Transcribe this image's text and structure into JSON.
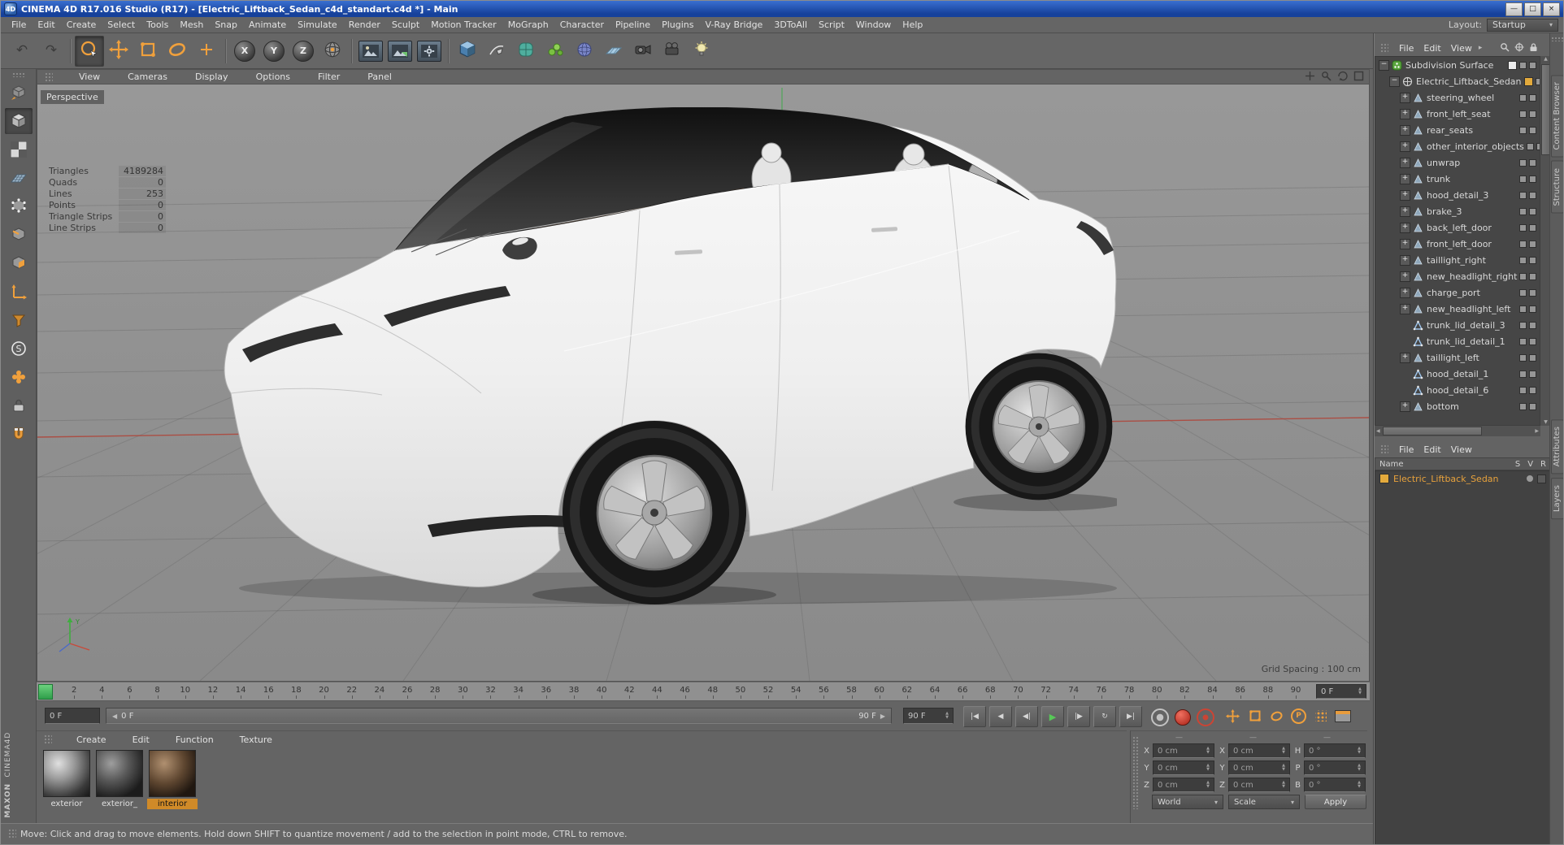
{
  "title_bar": {
    "title": "CINEMA 4D R17.016 Studio (R17) - [Electric_Liftback_Sedan_c4d_standart.c4d *] - Main",
    "window_buttons": {
      "minimize": "—",
      "maximize": "□",
      "close": "×"
    },
    "app_icon_text": "4D"
  },
  "menu_bar": {
    "items": [
      "File",
      "Edit",
      "Create",
      "Select",
      "Tools",
      "Mesh",
      "Snap",
      "Animate",
      "Simulate",
      "Render",
      "Sculpt",
      "Motion Tracker",
      "MoGraph",
      "Character",
      "Pipeline",
      "Plugins",
      "V-Ray Bridge",
      "3DToAll",
      "Script",
      "Window",
      "Help"
    ],
    "layout_label": "Layout:",
    "layout_value": "Startup"
  },
  "glyphs": {
    "undo": "↶",
    "redo": "↷",
    "axis_x": "X",
    "axis_y": "Y",
    "axis_z": "Z",
    "dropdown": "▾",
    "spin_up": "▲",
    "spin_down": "▼",
    "menu_more": "▸",
    "slider_left": "◀",
    "slider_right": "▶",
    "scroll_up": "▲",
    "scroll_down": "▼",
    "scroll_left": "◀",
    "scroll_right": "▶"
  },
  "viewport": {
    "menus": [
      "View",
      "Cameras",
      "Display",
      "Options",
      "Filter",
      "Panel"
    ],
    "label": "Perspective",
    "stats": [
      {
        "label": "Triangles",
        "value": "4189284"
      },
      {
        "label": "Quads",
        "value": "0"
      },
      {
        "label": "Lines",
        "value": "253"
      },
      {
        "label": "Points",
        "value": "0"
      },
      {
        "label": "Triangle Strips",
        "value": "0"
      },
      {
        "label": "Line Strips",
        "value": "0"
      }
    ],
    "grid_spacing": "Grid Spacing : 100 cm"
  },
  "timeline": {
    "start": 0,
    "end": 90,
    "label_step": 2,
    "ruler_field": "0 F",
    "current_field": "0 F",
    "range_start_label": "0 F",
    "range_end_label": "90 F",
    "end_field": "90 F",
    "buttons": [
      {
        "name": "goto-start-button",
        "glyph": "|◀"
      },
      {
        "name": "play-backward-button",
        "glyph": "◀"
      },
      {
        "name": "previous-frame-button",
        "glyph": "◀|"
      },
      {
        "name": "play-button",
        "glyph": "▶"
      },
      {
        "name": "next-frame-button",
        "glyph": "|▶"
      },
      {
        "name": "play-mode-button",
        "glyph": "↻"
      },
      {
        "name": "goto-end-button",
        "glyph": "▶|"
      }
    ]
  },
  "materials": {
    "menus": [
      "Create",
      "Edit",
      "Function",
      "Texture"
    ],
    "items": [
      {
        "label": "exterior",
        "tone": "light",
        "selected": false
      },
      {
        "label": "exterior_",
        "tone": "dark",
        "selected": false
      },
      {
        "label": "interior",
        "tone": "brown",
        "selected": true
      }
    ]
  },
  "coordinates": {
    "group_dashes": [
      "—",
      "—",
      "—"
    ],
    "rows": [
      {
        "pos_label": "X",
        "pos_value": "0 cm",
        "size_label": "X",
        "size_value": "0 cm",
        "rot_label": "H",
        "rot_value": "0 °"
      },
      {
        "pos_label": "Y",
        "pos_value": "0 cm",
        "size_label": "Y",
        "size_value": "0 cm",
        "rot_label": "P",
        "rot_value": "0 °"
      },
      {
        "pos_label": "Z",
        "pos_value": "0 cm",
        "size_label": "Z",
        "size_value": "0 cm",
        "rot_label": "B",
        "rot_value": "0 °"
      }
    ],
    "system_value": "World",
    "mode_value": "Scale",
    "apply_label": "Apply"
  },
  "object_manager": {
    "menus": [
      "File",
      "Edit",
      "View"
    ],
    "tree": [
      {
        "label": "Subdivision Surface",
        "depth": 0,
        "exp": "minus",
        "icon": "subdiv",
        "badge": "white"
      },
      {
        "label": "Electric_Liftback_Sedan",
        "depth": 1,
        "exp": "minus",
        "icon": "nullobj",
        "badge": "orange"
      },
      {
        "label": "steering_wheel",
        "depth": 2,
        "exp": "plus",
        "icon": "poly",
        "badge": null
      },
      {
        "label": "front_left_seat",
        "depth": 2,
        "exp": "plus",
        "icon": "poly",
        "badge": null
      },
      {
        "label": "rear_seats",
        "depth": 2,
        "exp": "plus",
        "icon": "poly",
        "badge": null
      },
      {
        "label": "other_interior_objects",
        "depth": 2,
        "exp": "plus",
        "icon": "poly",
        "badge": null
      },
      {
        "label": "unwrap",
        "depth": 2,
        "exp": "plus",
        "icon": "poly",
        "badge": null
      },
      {
        "label": "trunk",
        "depth": 2,
        "exp": "plus",
        "icon": "poly",
        "badge": null
      },
      {
        "label": "hood_detail_3",
        "depth": 2,
        "exp": "plus",
        "icon": "poly",
        "badge": null
      },
      {
        "label": "brake_3",
        "depth": 2,
        "exp": "plus",
        "icon": "poly",
        "badge": null
      },
      {
        "label": "back_left_door",
        "depth": 2,
        "exp": "plus",
        "icon": "poly",
        "badge": null
      },
      {
        "label": "front_left_door",
        "depth": 2,
        "exp": "plus",
        "icon": "poly",
        "badge": null
      },
      {
        "label": "taillight_right",
        "depth": 2,
        "exp": "plus",
        "icon": "poly",
        "badge": null
      },
      {
        "label": "new_headlight_right",
        "depth": 2,
        "exp": "plus",
        "icon": "poly",
        "badge": null
      },
      {
        "label": "charge_port",
        "depth": 2,
        "exp": "plus",
        "icon": "poly",
        "badge": null
      },
      {
        "label": "new_headlight_left",
        "depth": 2,
        "exp": "plus",
        "icon": "poly",
        "badge": null
      },
      {
        "label": "trunk_lid_detail_3",
        "depth": 2,
        "exp": "none",
        "icon": "polyA",
        "badge": null
      },
      {
        "label": "trunk_lid_detail_1",
        "depth": 2,
        "exp": "none",
        "icon": "polyA",
        "badge": null
      },
      {
        "label": "taillight_left",
        "depth": 2,
        "exp": "plus",
        "icon": "poly",
        "badge": null
      },
      {
        "label": "hood_detail_1",
        "depth": 2,
        "exp": "none",
        "icon": "polyA",
        "badge": null
      },
      {
        "label": "hood_detail_6",
        "depth": 2,
        "exp": "none",
        "icon": "polyA",
        "badge": null
      },
      {
        "label": "bottom",
        "depth": 2,
        "exp": "plus",
        "icon": "poly",
        "badge": null
      }
    ]
  },
  "layer_manager": {
    "menus": [
      "File",
      "Edit",
      "View"
    ],
    "name_header": "Name",
    "columns": [
      "S",
      "V",
      "R"
    ],
    "items": [
      {
        "label": "Electric_Liftback_Sedan",
        "color": "#e3aa3c"
      }
    ]
  },
  "side_tabs": {
    "top": [
      {
        "label": "Content Browser"
      },
      {
        "label": "Structure"
      }
    ],
    "bottom": [
      {
        "label": "Attributes"
      },
      {
        "label": "Layers"
      }
    ]
  },
  "status_bar": {
    "text": "Move: Click and drag to move elements. Hold down SHIFT to quantize movement / add to the selection in point mode, CTRL to remove."
  },
  "branding": {
    "maxon": "MAXON",
    "cinema": "CINEMA4D"
  }
}
